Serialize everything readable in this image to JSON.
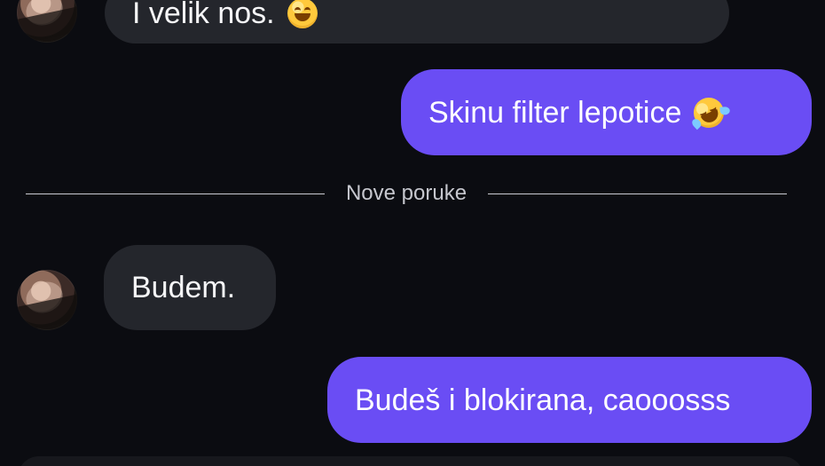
{
  "conversation": {
    "messages": [
      {
        "sender": "other",
        "text": "I velik nos.",
        "emoji": "grinning-face-with-smiling-eyes"
      },
      {
        "sender": "self",
        "text": "Skinu filter lepotice",
        "emoji": "rolling-on-the-floor-laughing"
      },
      {
        "sender": "other",
        "text": "Budem.",
        "emoji": ""
      },
      {
        "sender": "self",
        "text": "Budeš i blokirana, caooosss",
        "emoji": ""
      }
    ],
    "divider_label": "Nove poruke"
  },
  "colors": {
    "background": "#0b0c11",
    "incoming_bubble": "#24262c",
    "outgoing_bubble": "#6a4df4",
    "text_primary": "#f6f6f8",
    "divider": "#d7d8de"
  },
  "icons": {
    "avatar": "contact-avatar",
    "emoji_1": "grinning-face-icon",
    "emoji_2": "rofl-emoji-icon"
  }
}
